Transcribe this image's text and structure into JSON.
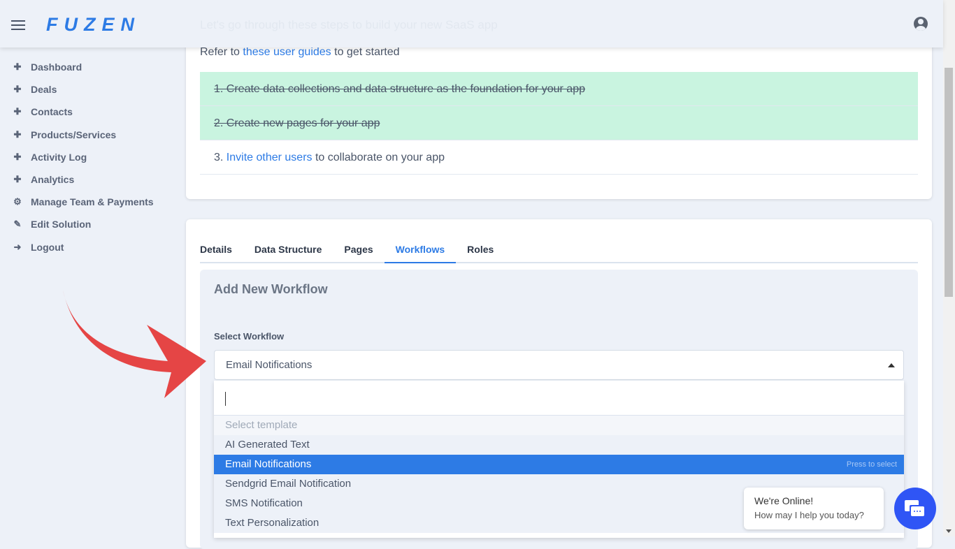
{
  "header": {
    "logo": "FUZEN",
    "faded_text": "Let's go through these steps to build your new SaaS app"
  },
  "sidebar": {
    "items": [
      {
        "label": "Dashboard",
        "icon": "puzzle-icon"
      },
      {
        "label": "Deals",
        "icon": "puzzle-icon"
      },
      {
        "label": "Contacts",
        "icon": "puzzle-icon"
      },
      {
        "label": "Products/Services",
        "icon": "puzzle-icon"
      },
      {
        "label": "Activity Log",
        "icon": "puzzle-icon"
      },
      {
        "label": "Analytics",
        "icon": "puzzle-icon"
      },
      {
        "label": "Manage Team & Payments",
        "icon": "users-cog-icon"
      },
      {
        "label": "Edit Solution",
        "icon": "pencil-icon"
      },
      {
        "label": "Logout",
        "icon": "sign-out-icon"
      }
    ]
  },
  "guide": {
    "prefix": "Refer to",
    "link": "these user guides",
    "suffix": "to get started",
    "steps": [
      {
        "text": "1. Create data collections and data structure as the foundation for your app"
      },
      {
        "text": "2. Create new pages for your app"
      },
      {
        "prefix": "3.",
        "link": "Invite other users",
        "suffix": "to collaborate on your app"
      }
    ]
  },
  "tabs": [
    "Details",
    "Data Structure",
    "Pages",
    "Workflows",
    "Roles"
  ],
  "workflow": {
    "title": "Add New Workflow",
    "label": "Select Workflow",
    "selected": "Email Notifications",
    "placeholder": "Select template",
    "options": [
      "AI Generated Text",
      "Email Notifications",
      "Sendgrid Email Notification",
      "SMS Notification",
      "Text Personalization"
    ],
    "hint": "Press to select"
  },
  "chat": {
    "title": "We're Online!",
    "subtitle": "How may I help you today?"
  },
  "colors": {
    "accent": "#2d7be5",
    "done": "#c9f4e0",
    "arrow": "#e54545",
    "chat": "#2f55f5"
  }
}
